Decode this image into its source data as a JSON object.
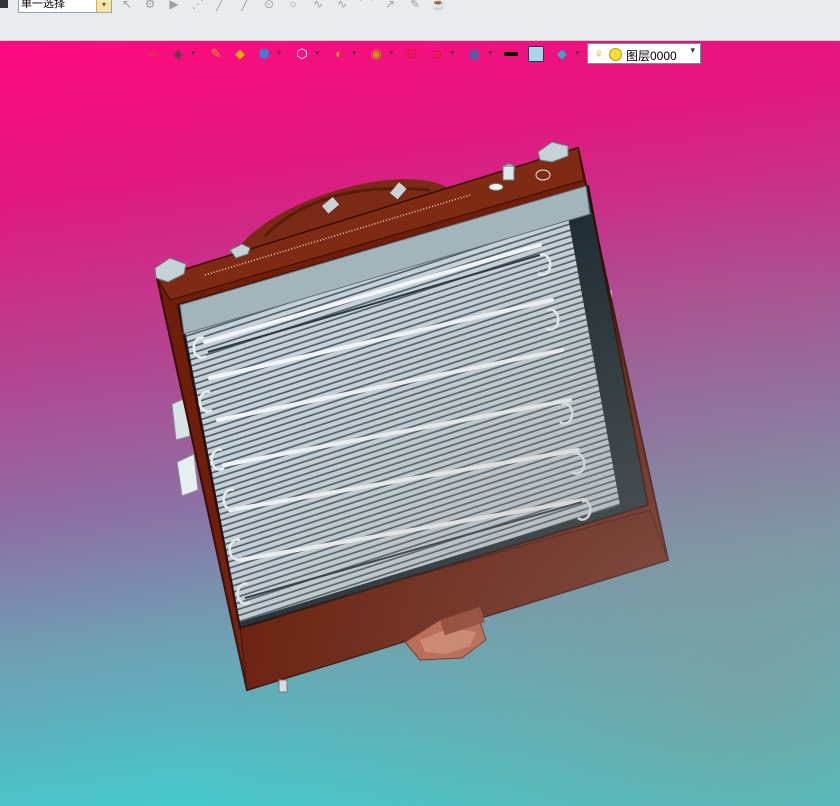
{
  "toolbar": {
    "selection_mode": "单一选择",
    "selection_dropdown_arrow": "▾",
    "icons": [
      "cursor-icon",
      "gear-icon",
      "play-icon",
      "points-icon",
      "line-icon",
      "arc-icon",
      "circle-point-icon",
      "circle-icon",
      "spline-icon",
      "curve-icon",
      "fillet-icon",
      "extend-icon",
      "paint-icon"
    ]
  },
  "view_toolbar": {
    "layer_label": "图层0000",
    "layer_dropdown": "▾",
    "icons": [
      "exit-icon",
      "view-icon",
      "pen-icon",
      "box-color-icon",
      "cube-shade-icon",
      "cube-wire-icon",
      "section-icon",
      "zoom-icon",
      "fit-icon",
      "dimension-icon",
      "monitor-icon",
      "line-weight-icon",
      "color-swatch-icon",
      "plane-icon",
      "bulb-icon",
      "sun-icon"
    ]
  },
  "colors": {
    "frame": "#6e1e0b",
    "frame_light": "#7f2a13",
    "fins": "#b9c7cf",
    "fins_dark": "#5e6f78",
    "fan_housing": "#7a2a15",
    "knob": "#c5664c",
    "bg_top": "#ff0a7f",
    "bg_bottom": "#2fdad8"
  }
}
